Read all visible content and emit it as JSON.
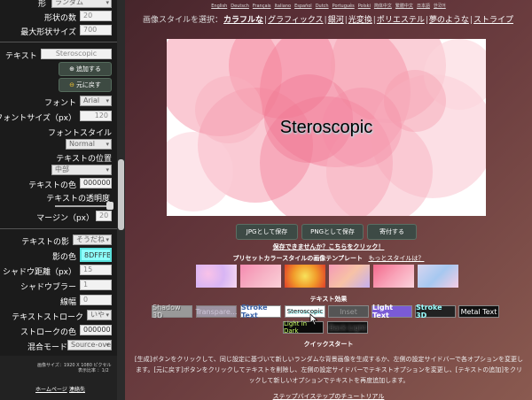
{
  "sidebar": {
    "shape": {
      "label": "形",
      "value": "ランダム"
    },
    "shape_count": {
      "label": "形状の数",
      "value": "20"
    },
    "max_shape_size": {
      "label": "最大形状サイズ",
      "value": "700"
    },
    "text": {
      "label": "テキスト",
      "value": "Steroscopic"
    },
    "add_button": "追加する",
    "restore_button": "元に戻す",
    "font": {
      "label": "フォント",
      "value": "Arial"
    },
    "font_size": {
      "label": "フォントサイズ（px）",
      "value": "120"
    },
    "font_style": {
      "label": "フォントスタイル",
      "value": "Normal"
    },
    "text_position": {
      "label": "テキストの位置",
      "value": "中部"
    },
    "text_color": {
      "label": "テキストの色",
      "value": "000000"
    },
    "text_opacity": {
      "label": "テキストの透明度"
    },
    "margin": {
      "label": "マージン（px）",
      "value": "20"
    },
    "text_shadow": {
      "label": "テキストの影",
      "value": "そうだね"
    },
    "shadow_color": {
      "label": "影の色",
      "value": "8DFFFB"
    },
    "shadow_distance": {
      "label": "シャドウ距離（px）",
      "value": "15"
    },
    "shadow_blur": {
      "label": "シャドウブラー",
      "value": "1"
    },
    "stroke_width": {
      "label": "線幅",
      "value": "0"
    },
    "text_stroke": {
      "label": "テキストストローク",
      "value": "いや"
    },
    "stroke_color": {
      "label": "ストロークの色",
      "value": "000000"
    },
    "blend_mode": {
      "label": "混合モード",
      "value": "Source-over"
    },
    "image_size": {
      "label": "画像サイズ：",
      "value": "1920 X 1080 ピクセル",
      "display_ratio": "表示比率 ：1/2"
    },
    "home_link": "ホームページ",
    "contact_link": "連絡先"
  },
  "main": {
    "languages": [
      "English",
      "Deutsch",
      "Français",
      "Italiano",
      "Español",
      "Dutch",
      "Português",
      "Polski",
      "简体中文",
      "繁體中文",
      "日本語",
      "한국어"
    ],
    "style_prefix": "画像スタイルを選択：",
    "styles": [
      "カラフルな",
      "グラフィックス",
      "銀河",
      "光変換",
      "ポリエステル",
      "夢のような",
      "ストライプ"
    ],
    "active_style": "カラフルな",
    "canvas_text": "Steroscopic",
    "save_jpg": "JPGとして保存",
    "save_png": "PNGとして保存",
    "donate": "寄付する",
    "cant_save": "保存できませんか？こちらをクリック！",
    "preset_title": "プリセットカラースタイルの画像テンプレート",
    "more_styles": "もっとスタイルは？",
    "effects_title": "テキスト効果",
    "effects": [
      "Shadow 3D",
      "Transpare...",
      "Stroke Text",
      "Steroscopic",
      "Inset",
      "Light Text",
      "Stroke 3D",
      "Metal Text",
      "Light in Dark",
      "Back Light"
    ],
    "quickstart_title": "クイックスタート",
    "quickstart_text": "[生成]ボタンをクリックして、同じ設定に基づいて新しいランダムな背景画像を生成するか、左側の設定サイドバーで各オプションを変更します。[元に戻す]ボタンをクリックしてテキストを削除し、左側の設定サイドバーでテキストオプションを変更し、[テキストの追加]をクリックして新しいオプションでテキストを再度追加します。",
    "tutorial_link": "ステップバイステップのチュートリアル"
  },
  "colors": {
    "sidebar_bg": "#1b1b1b",
    "shadow_color": "#8DFFFB"
  }
}
